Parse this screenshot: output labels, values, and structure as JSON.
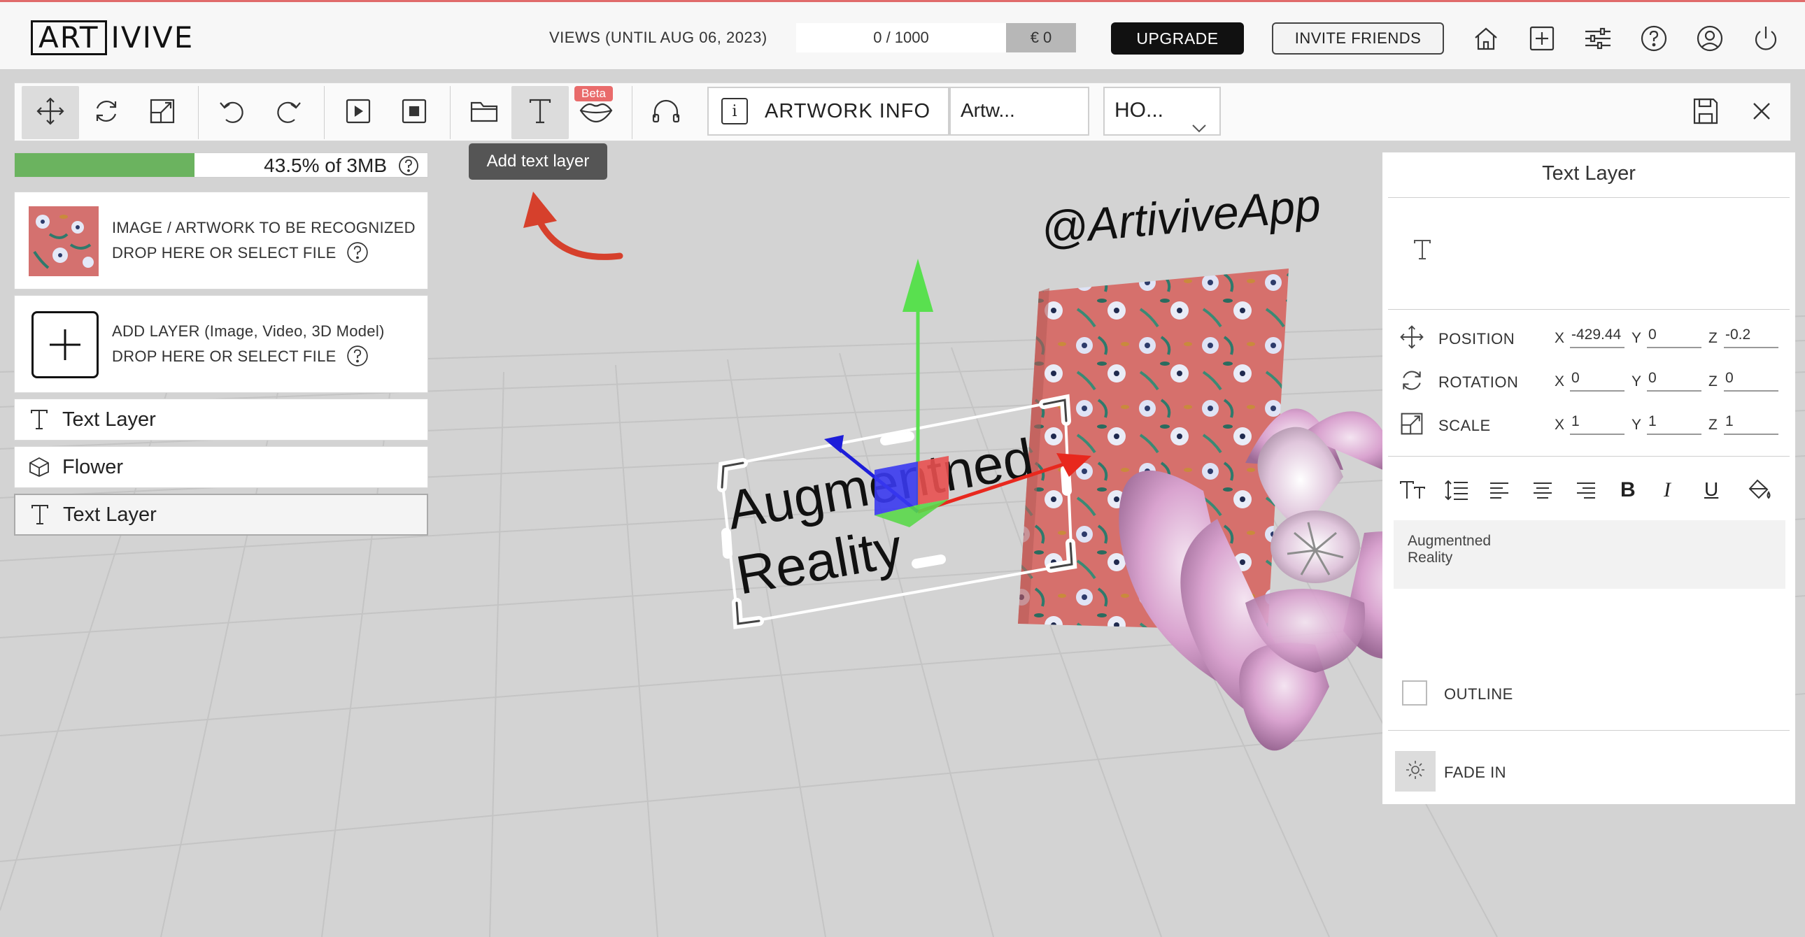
{
  "header": {
    "logo_boxed": "ART",
    "logo_rest": "IVIVE",
    "views_label": "VIEWS (UNTIL AUG 06, 2023)",
    "views_count": "0 / 1000",
    "views_cost": "€ 0",
    "upgrade_label": "UPGRADE",
    "invite_label": "INVITE FRIENDS",
    "icons": [
      "home-icon",
      "add-icon",
      "settings-sliders-icon",
      "help-icon",
      "user-icon",
      "power-icon"
    ]
  },
  "toolbar": {
    "tools": [
      "move-icon",
      "rotate-icon",
      "scale-icon",
      "undo-icon",
      "redo-icon",
      "play-icon",
      "stop-icon",
      "folder-icon",
      "text-icon",
      "lips-icon",
      "headphones-icon"
    ],
    "beta_label": "Beta",
    "artwork_info_label": "ARTWORK INFO",
    "artwork_name": "Artw...",
    "mode_select": "HO...",
    "tooltip": "Add text layer"
  },
  "storage": {
    "fraction": 0.435,
    "text": "43.5% of 3MB"
  },
  "artwork_card": {
    "line1": "IMAGE / ARTWORK TO BE RECOGNIZED",
    "line2": "DROP HERE OR SELECT FILE"
  },
  "add_layer_card": {
    "line1": "ADD LAYER (Image, Video, 3D Model)",
    "line2": "DROP HERE OR SELECT FILE"
  },
  "layers": [
    {
      "name": "Text Layer",
      "icon": "text-icon"
    },
    {
      "name": "Flower",
      "icon": "cube-icon"
    },
    {
      "name": "Text Layer",
      "icon": "text-icon",
      "selected": true
    }
  ],
  "scene": {
    "handle_text": "@ArtiviveApp",
    "text_line1": "Augmentned",
    "text_line2": "Reality"
  },
  "properties": {
    "title": "Text Layer",
    "position_label": "POSITION",
    "rotation_label": "ROTATION",
    "scale_label": "SCALE",
    "axis_x": "X",
    "axis_y": "Y",
    "axis_z": "Z",
    "position": {
      "x": "-429.44",
      "y": "0",
      "z": "-0.2"
    },
    "rotation": {
      "x": "0",
      "y": "0",
      "z": "0"
    },
    "scale": {
      "x": "1",
      "y": "1",
      "z": "1"
    },
    "text_content_line1": "Augmentned",
    "text_content_line2": "Reality",
    "outline_label": "OUTLINE",
    "fade_in_label": "FADE IN"
  },
  "colors": {
    "accent_red": "#e06b6b",
    "progress_green": "#6bb35f",
    "axis_green": "#59e04f",
    "axis_red": "#e8281e",
    "axis_blue": "#1d1dd9"
  }
}
